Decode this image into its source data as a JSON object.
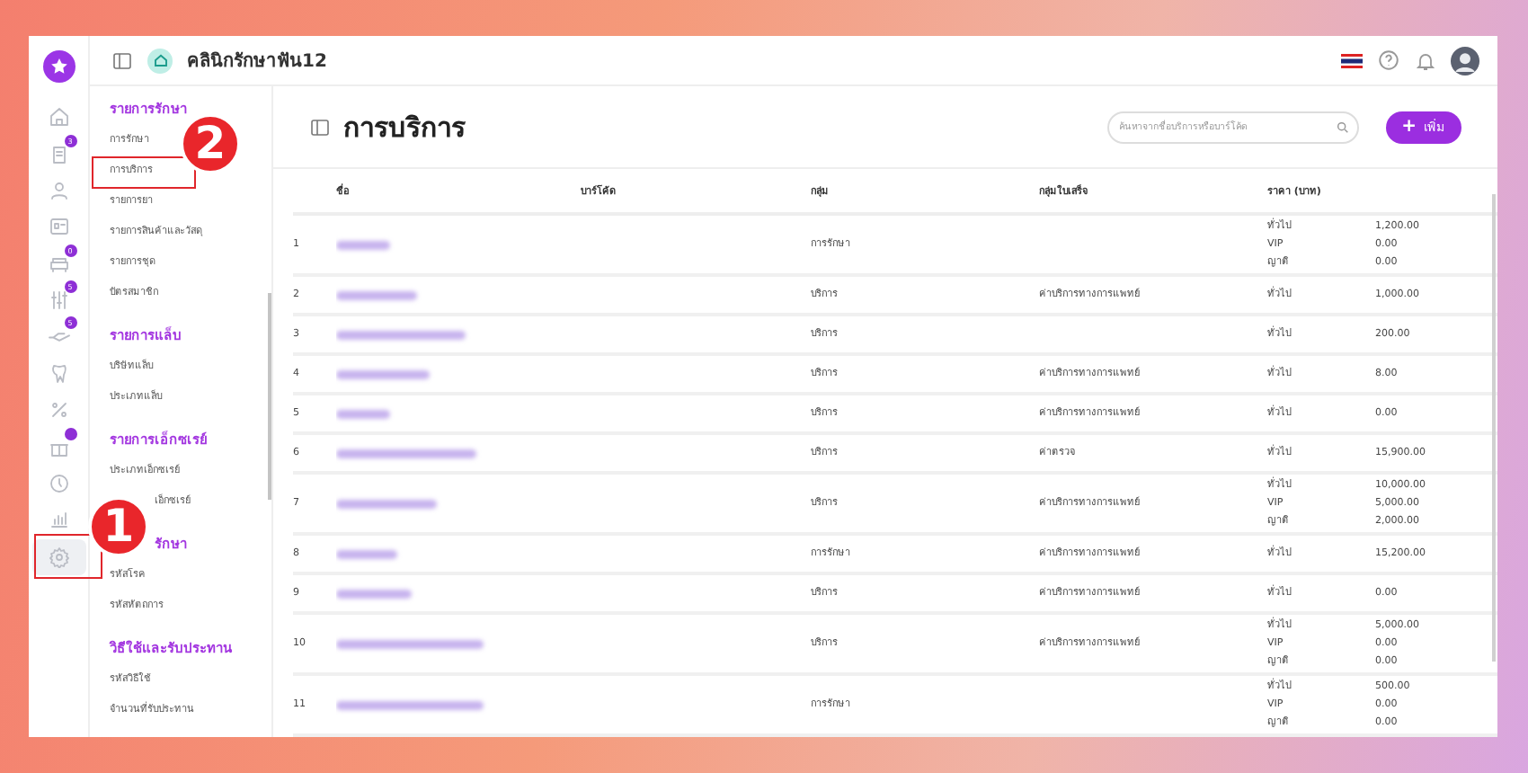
{
  "header": {
    "clinic_name": "คลินิกรักษาฟัน12"
  },
  "rail": [
    {
      "selected": false
    },
    {
      "selected": false,
      "badge": "3"
    },
    {
      "selected": false
    },
    {
      "selected": false
    },
    {
      "selected": false,
      "badge": "0"
    },
    {
      "selected": false,
      "badge": "5"
    },
    {
      "selected": false,
      "badge": "5"
    },
    {
      "selected": false
    },
    {
      "selected": false
    },
    {
      "selected": false,
      "dot": true
    },
    {
      "selected": false
    },
    {
      "selected": false
    },
    {
      "selected": true
    }
  ],
  "menu": [
    {
      "title": "รายการรักษา",
      "kind": "full",
      "items": [
        {
          "label": "การรักษา",
          "kind": "full"
        },
        {
          "label": "การบริการ",
          "kind": "full"
        },
        {
          "label": "รายการยา",
          "kind": "full"
        },
        {
          "label": "รายการสินค้าและวัสดุ",
          "kind": "full"
        },
        {
          "label": "รายการชุด",
          "kind": "full"
        },
        {
          "label": "บัตรสมาชิก",
          "kind": "full"
        }
      ]
    },
    {
      "title": "รายการแล็บ",
      "kind": "full",
      "items": [
        {
          "label": "บริษัทแล็บ",
          "kind": "full"
        },
        {
          "label": "ประเภทแล็บ",
          "kind": "full"
        }
      ]
    },
    {
      "title": "รายการเอ็กซเรย์",
      "kind": "full",
      "items": [
        {
          "label": "ประเภทเอ็กซเรย์",
          "kind": "full"
        },
        {
          "label": "เอ็กซเรย์",
          "kind": "partial"
        }
      ]
    },
    {
      "title": "รักษา",
      "kind": "partial",
      "items": [
        {
          "label": "รหัสโรค",
          "kind": "full"
        },
        {
          "label": "รหัสหัตถการ",
          "kind": "full"
        }
      ]
    },
    {
      "title": "วิธีใช้และรับประทาน",
      "kind": "full",
      "items": [
        {
          "label": "รหัสวิธีใช้",
          "kind": "full"
        },
        {
          "label": "จำนวนที่รับประทาน",
          "kind": "full"
        }
      ]
    }
  ],
  "page": {
    "title": "การบริการ",
    "search": {
      "placeholder": "ค้นหาจากชื่อบริการหรือบาร์โค้ด"
    },
    "add_button": "เพิ่ม",
    "add_icon": "+"
  },
  "table": {
    "columns": [
      "ชื่อ",
      "บาร์โค้ด",
      "กลุ่ม",
      "กลุ่มใบเสร็จ",
      "ราคา (บาท)"
    ],
    "rows": [
      {
        "no": "1",
        "group": "การรักษา",
        "prices": [
          {
            "tier": "ทั่วไป",
            "price": "1,200.00"
          },
          {
            "tier": "VIP",
            "price": "0.00"
          },
          {
            "tier": "ญาติ",
            "price": "0.00"
          }
        ]
      },
      {
        "no": "2",
        "group": "บริการ",
        "receipt_group": "ค่าบริการทางการแพทย์",
        "prices": [
          {
            "tier": "ทั่วไป",
            "price": "1,000.00"
          }
        ]
      },
      {
        "no": "3",
        "group": "บริการ",
        "prices": [
          {
            "tier": "ทั่วไป",
            "price": "200.00"
          }
        ]
      },
      {
        "no": "4",
        "group": "บริการ",
        "receipt_group": "ค่าบริการทางการแพทย์",
        "prices": [
          {
            "tier": "ทั่วไป",
            "price": "8.00"
          }
        ]
      },
      {
        "no": "5",
        "group": "บริการ",
        "receipt_group": "ค่าบริการทางการแพทย์",
        "prices": [
          {
            "tier": "ทั่วไป",
            "price": "0.00"
          }
        ]
      },
      {
        "no": "6",
        "group": "บริการ",
        "receipt_group": "ค่าตรวจ",
        "prices": [
          {
            "tier": "ทั่วไป",
            "price": "15,900.00"
          }
        ]
      },
      {
        "no": "7",
        "group": "บริการ",
        "receipt_group": "ค่าบริการทางการแพทย์",
        "prices": [
          {
            "tier": "ทั่วไป",
            "price": "10,000.00"
          },
          {
            "tier": "VIP",
            "price": "5,000.00"
          },
          {
            "tier": "ญาติ",
            "price": "2,000.00"
          }
        ]
      },
      {
        "no": "8",
        "group": "การรักษา",
        "receipt_group": "ค่าบริการทางการแพทย์",
        "prices": [
          {
            "tier": "ทั่วไป",
            "price": "15,200.00"
          }
        ]
      },
      {
        "no": "9",
        "group": "บริการ",
        "receipt_group": "ค่าบริการทางการแพทย์",
        "prices": [
          {
            "tier": "ทั่วไป",
            "price": "0.00"
          }
        ]
      },
      {
        "no": "10",
        "group": "บริการ",
        "receipt_group": "ค่าบริการทางการแพทย์",
        "prices": [
          {
            "tier": "ทั่วไป",
            "price": "5,000.00"
          },
          {
            "tier": "VIP",
            "price": "0.00"
          },
          {
            "tier": "ญาติ",
            "price": "0.00"
          }
        ]
      },
      {
        "no": "11",
        "group": "การรักษา",
        "prices": [
          {
            "tier": "ทั่วไป",
            "price": "500.00"
          },
          {
            "tier": "VIP",
            "price": "0.00"
          },
          {
            "tier": "ญาติ",
            "price": "0.00"
          }
        ]
      }
    ]
  },
  "annotations": [
    {
      "label": "1"
    },
    {
      "label": "2"
    }
  ]
}
